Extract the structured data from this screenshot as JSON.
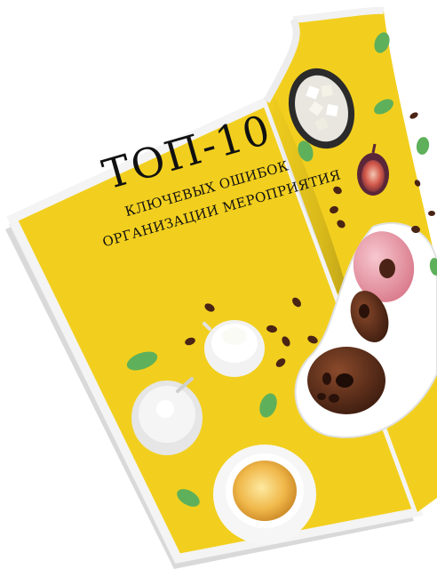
{
  "magazine": {
    "title_main": "ТОП-10",
    "subtitle_line1": "КЛЮЧЕВЫХ ОШИБОК",
    "subtitle_line2": "ОРГАНИЗАЦИИ МЕРОПРИЯТИЯ"
  },
  "colors": {
    "page_yellow": "#f2cf1e",
    "paper": "#f4f4f4",
    "mint_leaf": "#5fb05a",
    "coffee_bean": "#4a2414",
    "chocolate": "#5a2e1c",
    "pink_glaze": "#e79aa6"
  }
}
